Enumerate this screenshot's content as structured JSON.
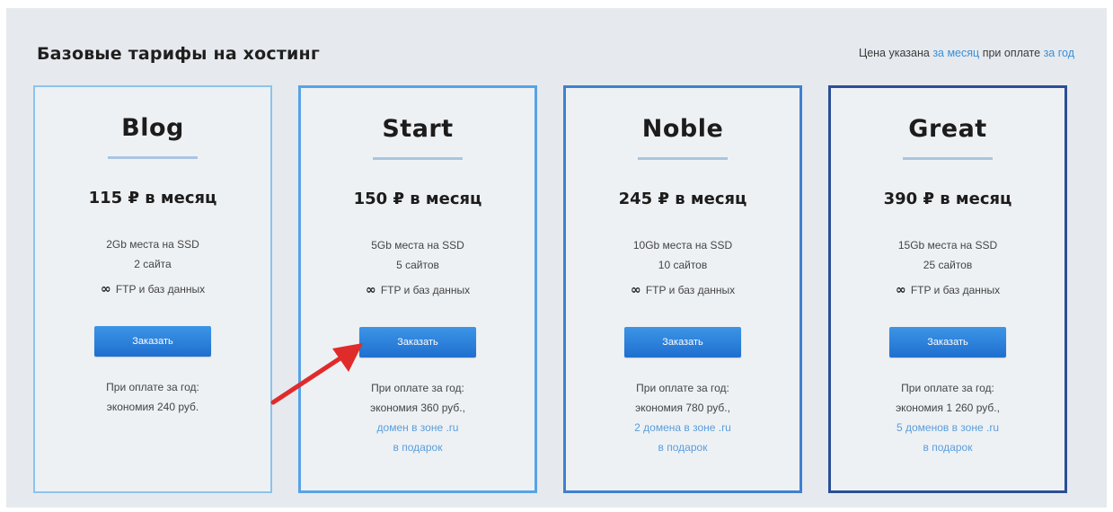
{
  "header": {
    "title": "Базовые тарифы на хостинг",
    "note_prefix": "Цена указана",
    "note_link1": "за месяц",
    "note_middle": "при оплате",
    "note_link2": "за год"
  },
  "plans": [
    {
      "name": "Blog",
      "price": "115 ₽ в месяц",
      "storage": "2Gb места на SSD",
      "sites": "2 сайта",
      "infinity": "∞",
      "ftp_db": "FTP и баз данных",
      "button": "Заказать",
      "note1": "При оплате за год:",
      "note2": "экономия 240 руб.",
      "note3": "",
      "note4": ""
    },
    {
      "name": "Start",
      "price": "150 ₽ в месяц",
      "storage": "5Gb места на SSD",
      "sites": "5 сайтов",
      "infinity": "∞",
      "ftp_db": "FTP и баз данных",
      "button": "Заказать",
      "note1": "При оплате за год:",
      "note2": "экономия 360 руб.,",
      "note3": "домен в зоне .ru",
      "note4": "в подарок"
    },
    {
      "name": "Noble",
      "price": "245 ₽ в месяц",
      "storage": "10Gb места на SSD",
      "sites": "10 сайтов",
      "infinity": "∞",
      "ftp_db": "FTP и баз данных",
      "button": "Заказать",
      "note1": "При оплате за год:",
      "note2": "экономия 780 руб.,",
      "note3": "2 домена в зоне .ru",
      "note4": "в подарок"
    },
    {
      "name": "Great",
      "price": "390 ₽ в месяц",
      "storage": "15Gb места на SSD",
      "sites": "25 сайтов",
      "infinity": "∞",
      "ftp_db": "FTP и баз данных",
      "button": "Заказать",
      "note1": "При оплате за год:",
      "note2": "экономия 1 260 руб.,",
      "note3": "5 доменов в зоне .ru",
      "note4": "в подарок"
    }
  ],
  "colors": {
    "panel_bg": "#e6eaee",
    "button": "#2a80d8",
    "link": "#3b8fd6",
    "arrow": "#e02b2b"
  }
}
